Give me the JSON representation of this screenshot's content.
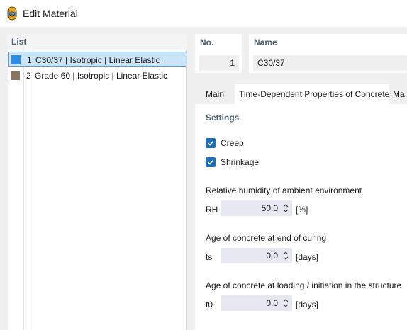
{
  "window": {
    "title": "Edit Material"
  },
  "list": {
    "header": "List",
    "items": [
      {
        "no": "1",
        "name": "C30/37 | Isotropic | Linear Elastic",
        "color": "#2f8be6",
        "selected": true
      },
      {
        "no": "2",
        "name": "Grade 60 | Isotropic | Linear Elastic",
        "color": "#8a7560",
        "selected": false
      }
    ]
  },
  "fields": {
    "no_label": "No.",
    "no_value": "1",
    "name_label": "Name",
    "name_value": "C30/37"
  },
  "tabs": [
    {
      "label": "Main",
      "active": false
    },
    {
      "label": "Time-Dependent Properties of Concrete",
      "active": true
    },
    {
      "label": "Ma",
      "active": false
    }
  ],
  "settings": {
    "title": "Settings",
    "creep": {
      "label": "Creep",
      "checked": true
    },
    "shrinkage": {
      "label": "Shrinkage",
      "checked": true
    },
    "rh": {
      "label": "Relative humidity of ambient environment",
      "symbol": "RH",
      "value": "50.0",
      "unit": "[%]"
    },
    "ts": {
      "label": "Age of concrete at end of curing",
      "symbol": "ts",
      "value": "0.0",
      "unit": "[days]"
    },
    "t0": {
      "label": "Age of concrete at loading / initiation in the structure",
      "symbol": "t0",
      "value": "0.0",
      "unit": "[days]"
    }
  },
  "colors": {
    "accent": "#1f6fb8",
    "header_text": "#4a6276",
    "selection": "#cce4f7"
  }
}
